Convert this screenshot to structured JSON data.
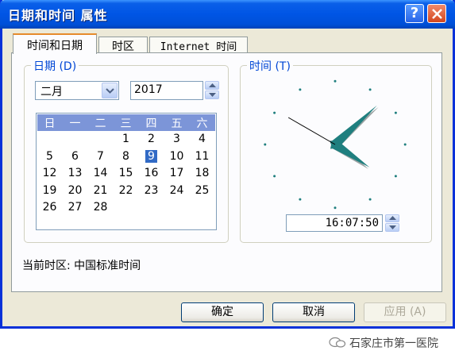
{
  "window": {
    "title": "日期和时间 属性"
  },
  "titlebar": {
    "help_label": "?"
  },
  "tabs": [
    {
      "label": "时间和日期",
      "active": true
    },
    {
      "label": "时区",
      "active": false
    },
    {
      "label": "Internet 时间",
      "active": false
    }
  ],
  "date_group": {
    "legend": "日期 (D)",
    "month_value": "二月",
    "year_value": "2017",
    "weekdays": [
      "日",
      "一",
      "二",
      "三",
      "四",
      "五",
      "六"
    ],
    "weeks": [
      [
        "",
        "",
        "",
        "1",
        "2",
        "3",
        "4"
      ],
      [
        "5",
        "6",
        "7",
        "8",
        "9",
        "10",
        "11"
      ],
      [
        "12",
        "13",
        "14",
        "15",
        "16",
        "17",
        "18"
      ],
      [
        "19",
        "20",
        "21",
        "22",
        "23",
        "24",
        "25"
      ],
      [
        "26",
        "27",
        "28",
        "",
        "",
        "",
        ""
      ]
    ],
    "selected_day": "9"
  },
  "time_group": {
    "legend": "时间 (T)",
    "time_value": "16:07:50",
    "clock": {
      "hour": 16,
      "minute": 7,
      "second": 50
    }
  },
  "timezone": {
    "label": "当前时区: 中国标准时间"
  },
  "buttons": {
    "ok": "确定",
    "cancel": "取消",
    "apply": "应用 (A)"
  },
  "watermark": {
    "text": "石家庄市第一医院"
  },
  "colors": {
    "title_blue": "#0055e5",
    "accent": "#0046d5",
    "calendar_header": "#7c95d8",
    "selection": "#316ac5",
    "clock_hand": "#1f7f7f"
  }
}
